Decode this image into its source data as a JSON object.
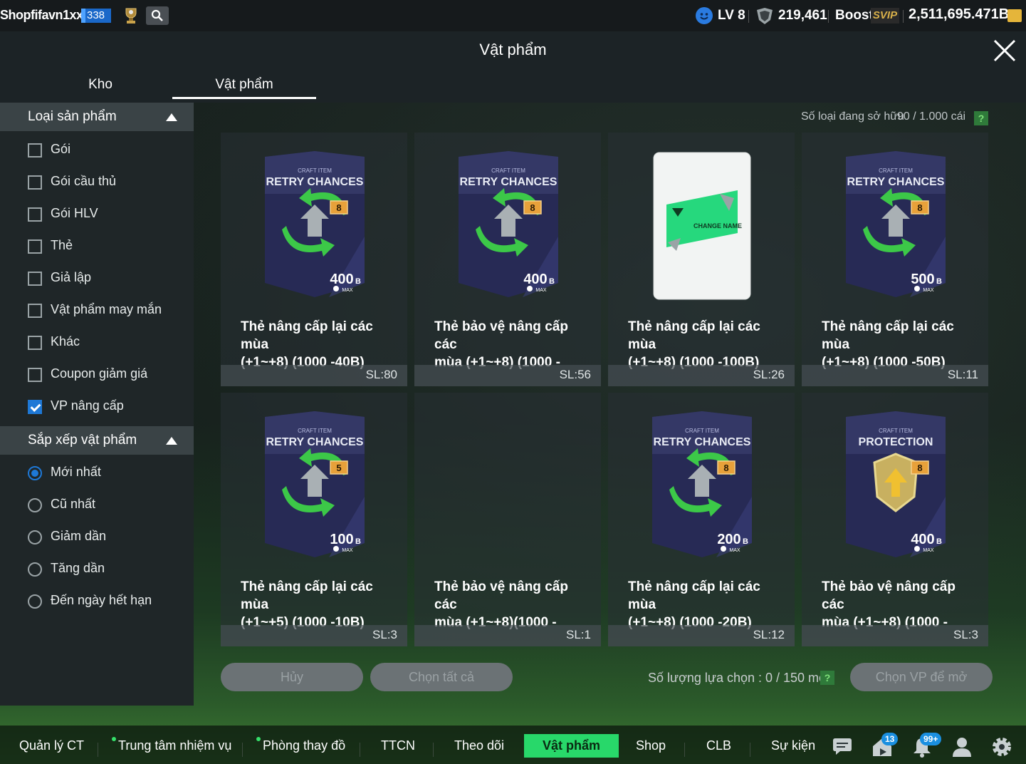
{
  "topbar": {
    "username": "Shopfifavn1xx",
    "level_badge": "338",
    "lv_text": "LV 8",
    "shield_value": "219,461",
    "boost_label": "Boost",
    "svip_label": "SVIP",
    "coins": "2,511,695.471B"
  },
  "header": {
    "title": "Vật phẩm"
  },
  "tabs": [
    {
      "label": "Kho"
    },
    {
      "label": "Vật phẩm"
    }
  ],
  "sidebar": {
    "filter_title": "Loại sản phẩm",
    "filters": [
      {
        "label": "Gói",
        "checked": false
      },
      {
        "label": "Gói cầu thủ",
        "checked": false
      },
      {
        "label": "Gói HLV",
        "checked": false
      },
      {
        "label": "Thẻ",
        "checked": false
      },
      {
        "label": "Giả lập",
        "checked": false
      },
      {
        "label": "Vật phẩm may mắn",
        "checked": false
      },
      {
        "label": "Khác",
        "checked": false
      },
      {
        "label": "Coupon giảm giá",
        "checked": false
      },
      {
        "label": "VP nâng cấp",
        "checked": true
      }
    ],
    "sort_title": "Sắp xếp vật phẩm",
    "sorts": [
      {
        "label": "Mới nhất",
        "selected": true
      },
      {
        "label": "Cũ nhất",
        "selected": false
      },
      {
        "label": "Giảm dần",
        "selected": false
      },
      {
        "label": "Tăng dần",
        "selected": false
      },
      {
        "label": "Đến ngày hết hạn",
        "selected": false
      }
    ]
  },
  "inventory": {
    "owned_label": "Số loại đang sở hữu",
    "owned_value": "90 / 1.000 cái",
    "help": "?"
  },
  "cards": [
    {
      "type": "retry",
      "craft": "CRAFT ITEM",
      "title": "RETRY CHANCES",
      "level": "8",
      "value": "400",
      "unit": "B",
      "max": "MAX",
      "name_line1": "Thẻ nâng cấp lại các mùa",
      "name_line2": "(+1~+8) (1000 -40B)",
      "qty": "SL:80"
    },
    {
      "type": "retry",
      "craft": "CRAFT ITEM",
      "title": "RETRY CHANCES",
      "level": "8",
      "value": "400",
      "unit": "B",
      "max": "MAX",
      "name_line1": "Thẻ bảo vệ nâng cấp các",
      "name_line2": "mùa (+1~+8) (1000 -",
      "qty": "SL:56"
    },
    {
      "type": "change",
      "craft": "",
      "title": "CHANGE NAME",
      "level": "",
      "value": "",
      "unit": "",
      "max": "",
      "name_line1": "Thẻ nâng cấp lại các mùa",
      "name_line2": "(+1~+8) (1000 -100B)",
      "qty": "SL:26"
    },
    {
      "type": "retry",
      "craft": "CRAFT ITEM",
      "title": "RETRY CHANCES",
      "level": "8",
      "value": "500",
      "unit": "B",
      "max": "MAX",
      "name_line1": "Thẻ nâng cấp lại các mùa",
      "name_line2": "(+1~+8) (1000 -50B)",
      "qty": "SL:11"
    },
    {
      "type": "retry",
      "craft": "CRAFT ITEM",
      "title": "RETRY CHANCES",
      "level": "5",
      "value": "100",
      "unit": "B",
      "max": "MAX",
      "name_line1": "Thẻ nâng cấp lại các mùa",
      "name_line2": "(+1~+5) (1000 -10B)",
      "qty": "SL:3"
    },
    {
      "type": "empty",
      "craft": "",
      "title": "",
      "level": "",
      "value": "",
      "unit": "",
      "max": "",
      "name_line1": "Thẻ bảo vệ nâng cấp các",
      "name_line2": "mùa (+1~+8)(1000 -",
      "qty": "SL:1"
    },
    {
      "type": "retry",
      "craft": "CRAFT ITEM",
      "title": "RETRY CHANCES",
      "level": "8",
      "value": "200",
      "unit": "B",
      "max": "MAX",
      "name_line1": "Thẻ nâng cấp lại các mùa",
      "name_line2": "(+1~+8) (1000 -20B)",
      "qty": "SL:12"
    },
    {
      "type": "protect",
      "craft": "CRAFT ITEM",
      "title": "PROTECTION",
      "level": "8",
      "value": "400",
      "unit": "B",
      "max": "MAX",
      "name_line1": "Thẻ bảo vệ nâng cấp các",
      "name_line2": "mùa (+1~+8) (1000 -",
      "qty": "SL:3"
    }
  ],
  "actions": {
    "cancel": "Hủy",
    "select_all": "Chọn tất cả",
    "select_count_label": "Số lượng lựa chọn : 0 / 150 món",
    "open": "Chọn VP để mở"
  },
  "nav": {
    "items": [
      {
        "label": "Quản lý CT",
        "dot": false,
        "active": false
      },
      {
        "label": "Trung tâm nhiệm vụ",
        "dot": true,
        "active": false
      },
      {
        "label": "Phòng thay đồ",
        "dot": true,
        "active": false
      },
      {
        "label": "TTCN",
        "dot": false,
        "active": false
      },
      {
        "label": "Theo dõi",
        "dot": false,
        "active": false
      },
      {
        "label": "Vật phẩm",
        "dot": false,
        "active": true
      },
      {
        "label": "Shop",
        "dot": false,
        "active": false
      },
      {
        "label": "CLB",
        "dot": false,
        "active": false
      },
      {
        "label": "Sự kiện",
        "dot": false,
        "active": false
      }
    ],
    "badge_home": "13",
    "badge_bell": "99+"
  },
  "colors": {
    "accent_green": "#28d86a",
    "checkbox_blue": "#1e78d6",
    "card_purple": "#2a2a5e",
    "svip_gold": "#d8b04a"
  }
}
